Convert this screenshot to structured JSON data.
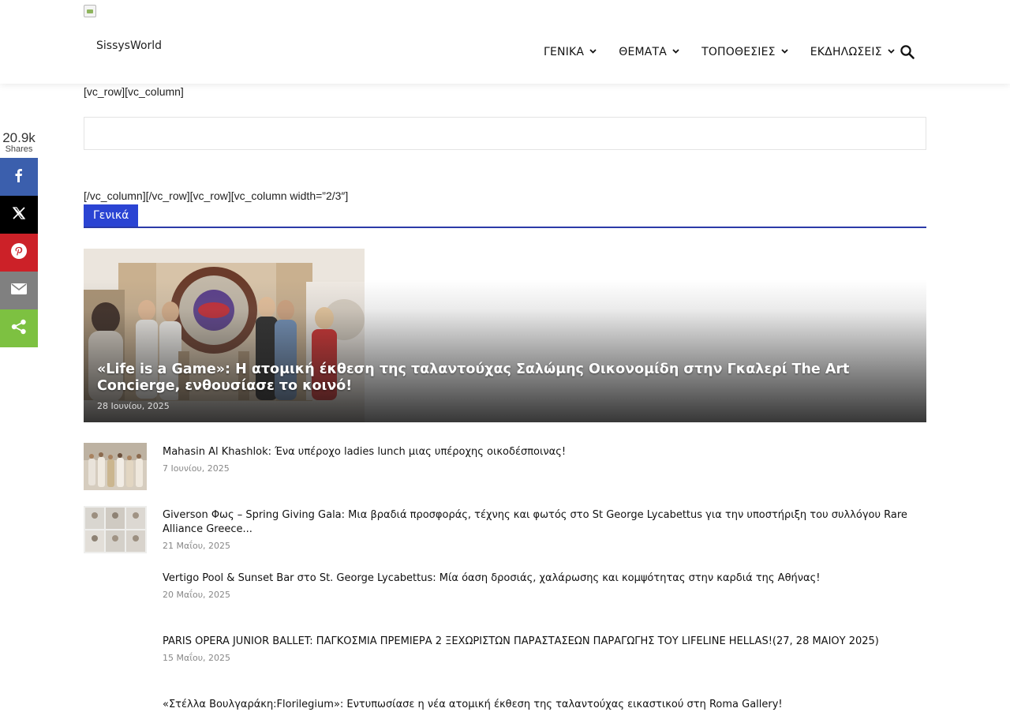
{
  "header": {
    "site_name": "SissysWorld",
    "nav": [
      {
        "label": "ΓΕΝΙΚΑ"
      },
      {
        "label": "ΘΕΜΑΤΑ"
      },
      {
        "label": "ΤΟΠΟΘΕΣΙΕΣ"
      },
      {
        "label": "ΕΚΔΗΛΩΣΕΙΣ"
      }
    ],
    "search_icon": "search-icon",
    "chevron_glyph": "⌄"
  },
  "content": {
    "shortcode_top": "[vc_row][vc_column]",
    "shortcode_mid": "[/vc_column][/vc_row][vc_row][vc_column width=”2/3″]",
    "block_title": "Γενικά"
  },
  "share": {
    "count": "20.9k",
    "label": "Shares",
    "buttons": [
      {
        "icon": "facebook-icon",
        "color": "#3b5fad"
      },
      {
        "icon": "x-icon",
        "color": "#000000"
      },
      {
        "icon": "pinterest-icon",
        "color": "#cc2128"
      },
      {
        "icon": "email-icon",
        "color": "#808080"
      },
      {
        "icon": "share-icon",
        "color": "#7dc141"
      }
    ]
  },
  "featured": {
    "title": "«Life is a Game»: Η ατομική έκθεση της ταλαντούχας Σαλώμης Οικονομίδη στην Γκαλερί The Art Concierge, ενθουσίασε το κοινό!",
    "date": "28 Ιουνίου, 2025"
  },
  "articles": [
    {
      "title": "Mahasin Al Khashlok: Ένα υπέροχο ladies lunch μιας υπέροχης οικοδέσποινας!",
      "date": "7 Ιουνίου, 2025",
      "has_thumb": true
    },
    {
      "title": "Giverson Φως – Spring Giving Gala: Μια βραδιά προσφοράς, τέχνης και φωτός στο St George Lycabettus για την υποστήριξη του συλλόγου Rare Alliance Greece...",
      "date": "21 Μαΐου, 2025",
      "has_thumb": true
    },
    {
      "title": "Vertigo Pool & Sunset Bar στο St. George Lycabettus: Μία όαση δροσιάς, χαλάρωσης και κομψότητας στην καρδιά της Αθήνας!",
      "date": "20 Μαΐου, 2025",
      "has_thumb": false
    },
    {
      "title": "PARIS OPERA JUNIOR BALLET: ΠΑΓΚΟΣΜΙΑ ΠΡΕΜΙΕΡΑ 2 ΞΕΧΩΡΙΣΤΩΝ ΠΑΡΑΣΤΑΣΕΩΝ ΠΑΡΑΓΩΓΗΣ ΤΟΥ LIFELINE HELLAS!(27, 28 ΜΑΙΟΥ 2025)",
      "date": "15 Μαΐου, 2025",
      "has_thumb": false
    },
    {
      "title": "«Στέλλα Βουλγαράκη:Florilegium»: Εντυπωσίασε η νέα ατομική έκθεση της ταλαντούχας εικαστικού στη Roma Gallery!",
      "date": "",
      "has_thumb": false
    }
  ]
}
